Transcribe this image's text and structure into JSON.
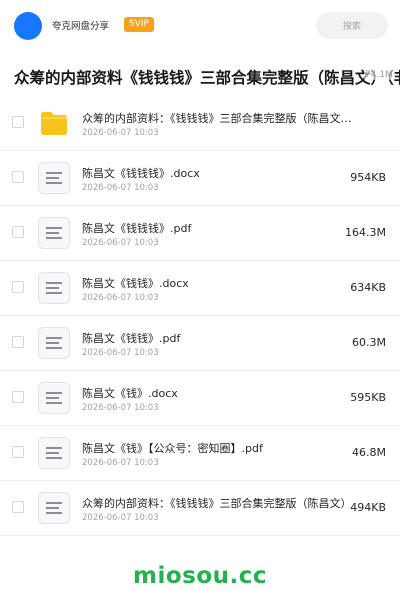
{
  "header": {
    "brand": "夸克网盘分享",
    "badge": "SVIP",
    "search_placeholder": "搜索"
  },
  "share": {
    "title": "众筹的内部资料《钱钱钱》三部合集完整版（陈昌文）（非",
    "title_size": "74.1M"
  },
  "files": [
    {
      "type": "folder",
      "name": "众筹的内部资料：《钱钱钱》三部合集完整版（陈昌文）（非常...",
      "date": "2026-06-07 10:03",
      "size": ""
    },
    {
      "type": "doc",
      "name": "陈昌文《钱钱钱》.docx",
      "date": "2026-06-07 10:03",
      "size": "954KB"
    },
    {
      "type": "doc",
      "name": "陈昌文《钱钱钱》.pdf",
      "date": "2026-06-07 10:03",
      "size": "164.3M"
    },
    {
      "type": "doc",
      "name": "陈昌文《钱钱》.docx",
      "date": "2026-06-07 10:03",
      "size": "634KB"
    },
    {
      "type": "doc",
      "name": "陈昌文《钱钱》.pdf",
      "date": "2026-06-07 10:03",
      "size": "60.3M"
    },
    {
      "type": "doc",
      "name": "陈昌文《钱》.docx",
      "date": "2026-06-07 10:03",
      "size": "595KB"
    },
    {
      "type": "doc",
      "name": "陈昌文《钱》【公众号：密知圈】.pdf",
      "date": "2026-06-07 10:03",
      "size": "46.8M"
    },
    {
      "type": "doc",
      "name": "众筹的内部资料：《钱钱钱》三部合集完整版（陈昌文）",
      "date": "2026-06-07 10:03",
      "size": "494KB"
    }
  ],
  "watermark": "miosou.cc",
  "colors": {
    "avatar": "#1677ff",
    "svip_badge": "#f7a21a",
    "folder": "#f9c419",
    "watermark": "#22b14c"
  }
}
